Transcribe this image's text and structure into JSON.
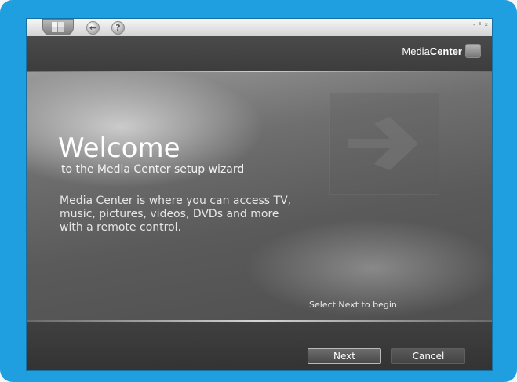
{
  "titlebar": {
    "window_controls": "- ᴱ ×",
    "start_icon": "windows-logo-icon",
    "back_icon": "back-arrow-icon",
    "help_icon": "help-icon"
  },
  "header": {
    "brand_regular": "Media",
    "brand_bold": "Center"
  },
  "main": {
    "title": "Welcome",
    "subtitle": "to the Media Center setup wizard",
    "description": "Media Center is where you can access TV, music, pictures, videos, DVDs and more with a remote control.",
    "status": "Select Next to begin",
    "decor_icon": "right-arrow-icon"
  },
  "footer": {
    "next_label": "Next",
    "cancel_label": "Cancel"
  },
  "colors": {
    "frame": "#1f9ee0",
    "window_bg": "#3b3b3b",
    "text": "#ffffff"
  }
}
